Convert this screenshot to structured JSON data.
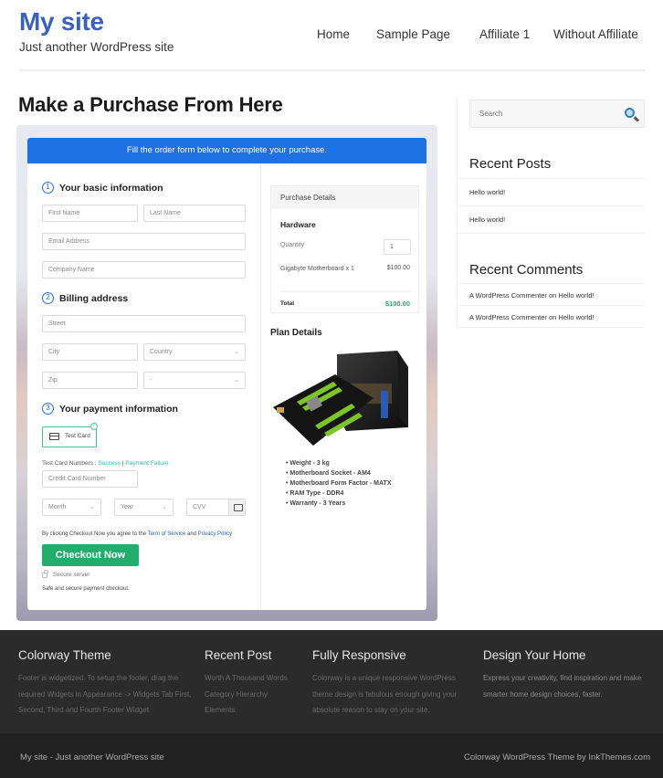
{
  "header": {
    "site_title": "My site",
    "tagline": "Just another WordPress site",
    "nav": [
      "Home",
      "Sample Page",
      "Affiliate 1",
      "Without Affiliate"
    ]
  },
  "page": {
    "title": "Make a Purchase From Here"
  },
  "form": {
    "banner": "Fill the order form below to complete your purchase.",
    "steps": [
      {
        "num": "1",
        "label": "Your basic information"
      },
      {
        "num": "2",
        "label": "Billing address"
      },
      {
        "num": "3",
        "label": "Your payment information"
      }
    ],
    "placeholders": {
      "first_name": "First Name",
      "last_name": "Last Name",
      "email": "Email Address",
      "company": "Company Name",
      "street": "Street",
      "city": "City",
      "country": "Country",
      "zip": "Zip",
      "state": "-",
      "card_number": "Credit Card Number",
      "month": "Month",
      "year": "Year",
      "cvv": "CVV"
    },
    "payment_method": "Test Card",
    "test_card_label": "Test Card Numbers : ",
    "test_success": "Success",
    "test_separator": " | ",
    "test_failure": "Payment Failure",
    "agree_prefix": "By clicking Checkout Now you agree to the ",
    "terms": "Term of Service",
    "agree_and": " and ",
    "privacy": "Privacy Policy",
    "checkout_button": "Checkout Now",
    "secure_label": "Secure server",
    "safe_label": "Safe and secure payment checkout."
  },
  "purchase": {
    "heading": "Purchase Details",
    "category": "Hardware",
    "quantity_label": "Quantity",
    "quantity": "1",
    "item": "Gigabyte Motherboard x 1",
    "item_price": "$100.00",
    "total_label": "Total",
    "total": "$100.00",
    "plan_heading": "Plan Details",
    "specs": [
      "Weight - 3 kg",
      "Motherboard Socket - AM4",
      "Motherboard Form Factor - MATX",
      "RAM Type - DDR4",
      "Warranty - 3 Years"
    ]
  },
  "sidebar": {
    "search_placeholder": "Search",
    "recent_posts_heading": "Recent Posts",
    "recent_posts": [
      "Hello world!",
      "Hello world!"
    ],
    "recent_comments_heading": "Recent Comments",
    "recent_comments": [
      "A WordPress Commenter on Hello world!",
      "A WordPress Commenter on Hello world!"
    ]
  },
  "footer": {
    "columns": [
      {
        "title": "Colorway Theme",
        "text": "Footer is widgetized. To setup the footer, drag the required Widgets in Appearance -> Widgets Tab First, Second, Third and Fourth Footer Widget"
      },
      {
        "title": "Recent Post",
        "links": [
          "Worth A Thousand Words",
          "Category Hierarchy",
          "Elements"
        ]
      },
      {
        "title": "Fully Responsive",
        "text": "Colorway is a unique responsive WordPress theme design is fabulous enough giving your absolute reason to stay on your site."
      },
      {
        "title": "Design Your Home",
        "text": "Express your creativity, find inspiration and make smarter home design choices, faster."
      }
    ],
    "bottom_left": "My site - Just another WordPress site",
    "bottom_right": "Colorway WordPress Theme by InkThemes.com"
  },
  "colors": {
    "brand": "#3b62b8",
    "banner": "#1f6fe5",
    "checkout": "#21ad6c",
    "total": "#21ad6c",
    "footer_bg": "#2b2b2b"
  }
}
